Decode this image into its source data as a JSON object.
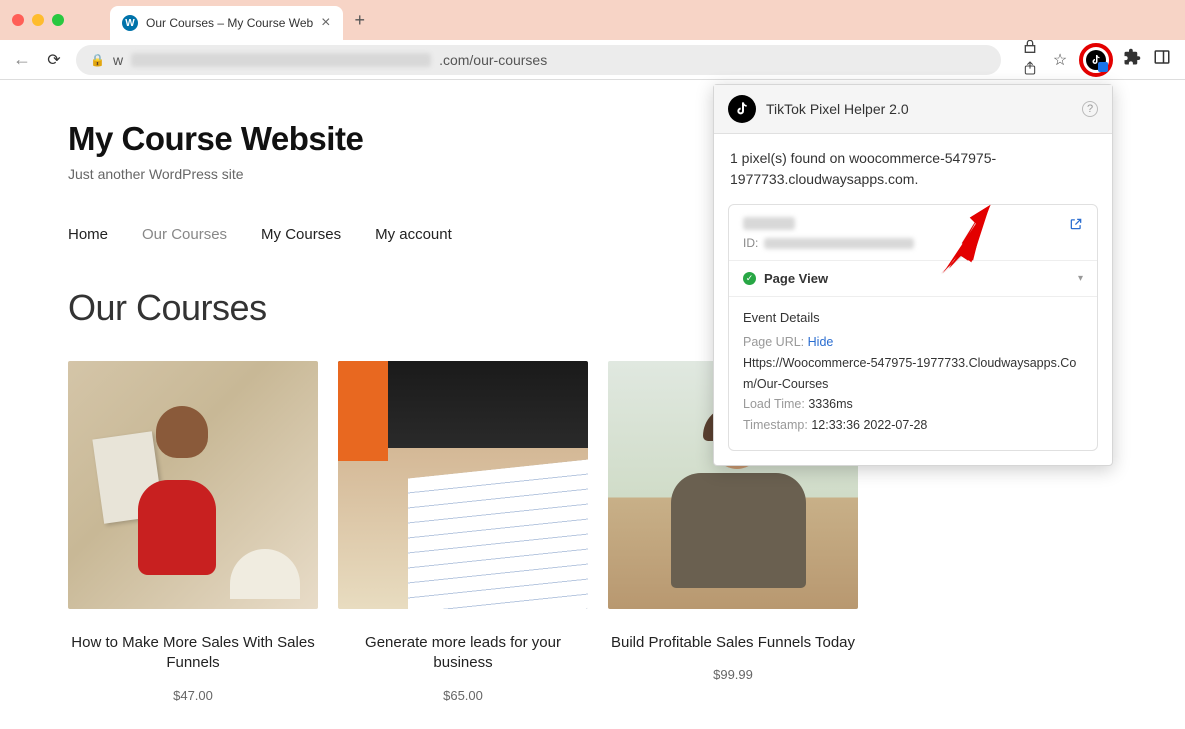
{
  "browser": {
    "tab_title": "Our Courses – My Course Web",
    "url_prefix": "w",
    "url_suffix": ".com/our-courses"
  },
  "site": {
    "title": "My Course Website",
    "tagline": "Just another WordPress site",
    "nav": [
      "Home",
      "Our Courses",
      "My Courses",
      "My account"
    ],
    "active_nav_index": 1,
    "page_heading": "Our Courses"
  },
  "courses": [
    {
      "title": "How to Make More Sales With Sales Funnels",
      "price": "$47.00"
    },
    {
      "title": "Generate more leads for your business",
      "price": "$65.00"
    },
    {
      "title": "Build Profitable Sales Funnels Today",
      "price": "$99.99"
    }
  ],
  "popup": {
    "title": "TikTok Pixel Helper 2.0",
    "summary": "1 pixel(s) found on woocommerce-547975-1977733.cloudwaysapps.com.",
    "pixel_id_label": "ID:",
    "event_name": "Page View",
    "details_heading": "Event Details",
    "page_url_label": "Page URL:",
    "page_url_action": "Hide",
    "page_url_value": "Https://Woocommerce-547975-1977733.Cloudwaysapps.Com/Our-Courses",
    "load_time_label": "Load Time:",
    "load_time_value": "3336ms",
    "timestamp_label": "Timestamp:",
    "timestamp_value": "12:33:36 2022-07-28"
  }
}
